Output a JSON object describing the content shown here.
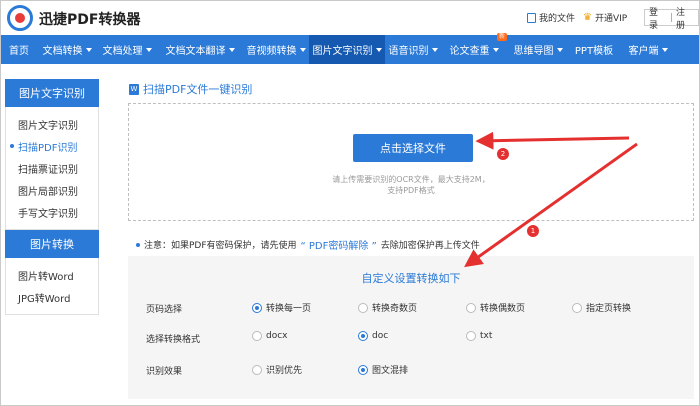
{
  "header": {
    "brand": "迅捷PDF转换器",
    "my_files": "我的文件",
    "vip": "开通VIP",
    "login": "登录",
    "separator": "|",
    "register": "注册"
  },
  "nav": {
    "items": [
      {
        "label": "首页",
        "caret": false
      },
      {
        "label": "文档转换",
        "caret": true
      },
      {
        "label": "文档处理",
        "caret": true
      },
      {
        "label": "文档文本翻译",
        "caret": true
      },
      {
        "label": "音视频转换",
        "caret": true
      },
      {
        "label": "图片文字识别",
        "caret": true,
        "active": true
      },
      {
        "label": "语音识别",
        "caret": true
      },
      {
        "label": "论文查重",
        "caret": true,
        "badge": "新"
      },
      {
        "label": "思维导图",
        "caret": true
      },
      {
        "label": "PPT模板",
        "caret": false
      },
      {
        "label": "客户端",
        "caret": true
      }
    ]
  },
  "sidebar": {
    "group1": {
      "title": "图片文字识别",
      "items": [
        "图片文字识别",
        "扫描PDF识别",
        "扫描票证识别",
        "图片局部识别",
        "手写文字识别"
      ]
    },
    "group2": {
      "title": "图片转换",
      "items": [
        "图片转Word",
        "JPG转Word"
      ]
    }
  },
  "main": {
    "icon_letter": "W",
    "title": "扫描PDF文件一键识别",
    "pick_button": "点击选择文件",
    "hint_line1": "请上传需要识别的OCR文件，最大支持2M，",
    "hint_line2": "支持PDF格式",
    "notice_prefix": "注意：如果PDF有密码保护，请先使用",
    "notice_link": "“ PDF密码解除 ”",
    "notice_suffix": "去除加密保护再上传文件"
  },
  "settings": {
    "title": "自定义设置转换如下",
    "rows": [
      {
        "label": "页码选择",
        "options": [
          {
            "text": "转换每一页",
            "selected": true
          },
          {
            "text": "转换奇数页",
            "selected": false
          },
          {
            "text": "转换偶数页",
            "selected": false
          },
          {
            "text": "指定页转换",
            "selected": false
          }
        ]
      },
      {
        "label": "选择转换格式",
        "options": [
          {
            "text": "docx",
            "selected": false
          },
          {
            "text": "doc",
            "selected": true
          },
          {
            "text": "txt",
            "selected": false
          }
        ]
      },
      {
        "label": "识别效果",
        "options": [
          {
            "text": "识别优先",
            "selected": false
          },
          {
            "text": "图文混排",
            "selected": true
          }
        ]
      }
    ]
  },
  "annotations": {
    "marker1": "1",
    "marker2": "2"
  },
  "colors": {
    "accent": "#2b7ad8",
    "annotation": "#e53030"
  }
}
